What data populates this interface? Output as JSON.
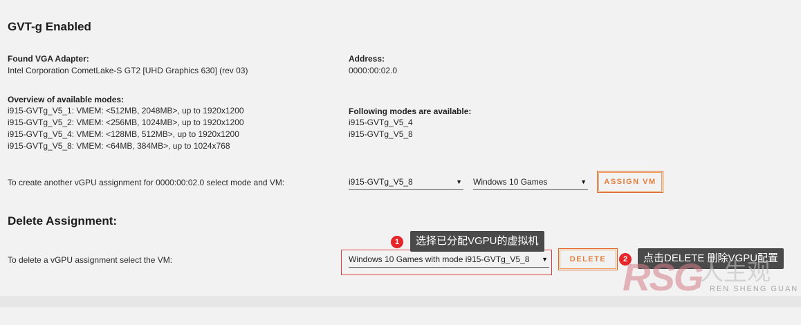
{
  "gvt": {
    "title": "GVT-g Enabled",
    "found_label": "Found VGA Adapter:",
    "found_value": "Intel Corporation CometLake-S GT2 [UHD Graphics 630] (rev 03)",
    "address_label": "Address:",
    "address_value": "0000:00:02.0",
    "overview_label": "Overview of available modes:",
    "modes": [
      "i915-GVTg_V5_1: VMEM: <512MB, 2048MB>, up to 1920x1200",
      "i915-GVTg_V5_2: VMEM: <256MB, 1024MB>, up to 1920x1200",
      "i915-GVTg_V5_4: VMEM: <128MB, 512MB>, up to 1920x1200",
      "i915-GVTg_V5_8: VMEM: <64MB, 384MB>, up to 1024x768"
    ],
    "following_label": "Following modes are available:",
    "available": [
      "i915-GVTg_V5_4",
      "i915-GVTg_V5_8"
    ],
    "create_text": "To create another vGPU assignment for 0000:00:02.0 select mode and VM:",
    "mode_select": "i915-GVTg_V5_8",
    "vm_select": "Windows 10 Games",
    "assign_button": "ASSIGN VM"
  },
  "delete": {
    "title": "Delete Assignment:",
    "text": "To delete a vGPU assignment select the VM:",
    "select_value": "Windows 10 Games with mode i915-GVTg_V5_8",
    "button": "DELETE"
  },
  "annotations": [
    {
      "number": "1",
      "text": "选择已分配VGPU的虚拟机"
    },
    {
      "number": "2",
      "text": "点击DELETE 删除VGPU配置"
    }
  ],
  "watermark": {
    "logo": "RSG",
    "cn": "人生观",
    "en": "REN SHENG GUAN"
  },
  "icons": {
    "dropdown": "triangle-down-icon"
  },
  "colors": {
    "accent": "#e37d3b",
    "annotation_red": "#e5262a",
    "callout_bg": "#4a4a4a"
  }
}
